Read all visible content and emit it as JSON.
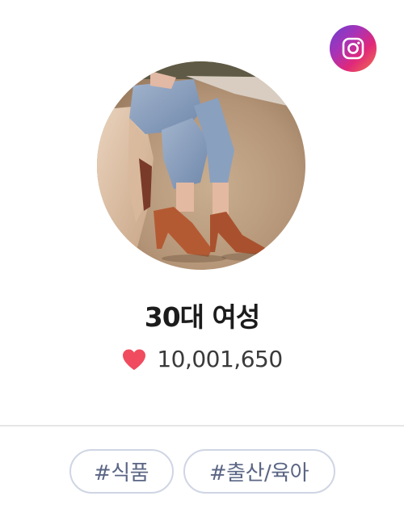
{
  "profile": {
    "name": "30대 여성",
    "likes": "10,001,650"
  },
  "tags": [
    {
      "label": "#식품"
    },
    {
      "label": "#출산/육아"
    }
  ],
  "icons": {
    "social": "instagram-icon",
    "like": "heart-icon"
  },
  "colors": {
    "heart": "#f04b5f",
    "tag_border": "#cfd5e4",
    "tag_text": "#5b6685",
    "name_text": "#1c1c1c"
  }
}
